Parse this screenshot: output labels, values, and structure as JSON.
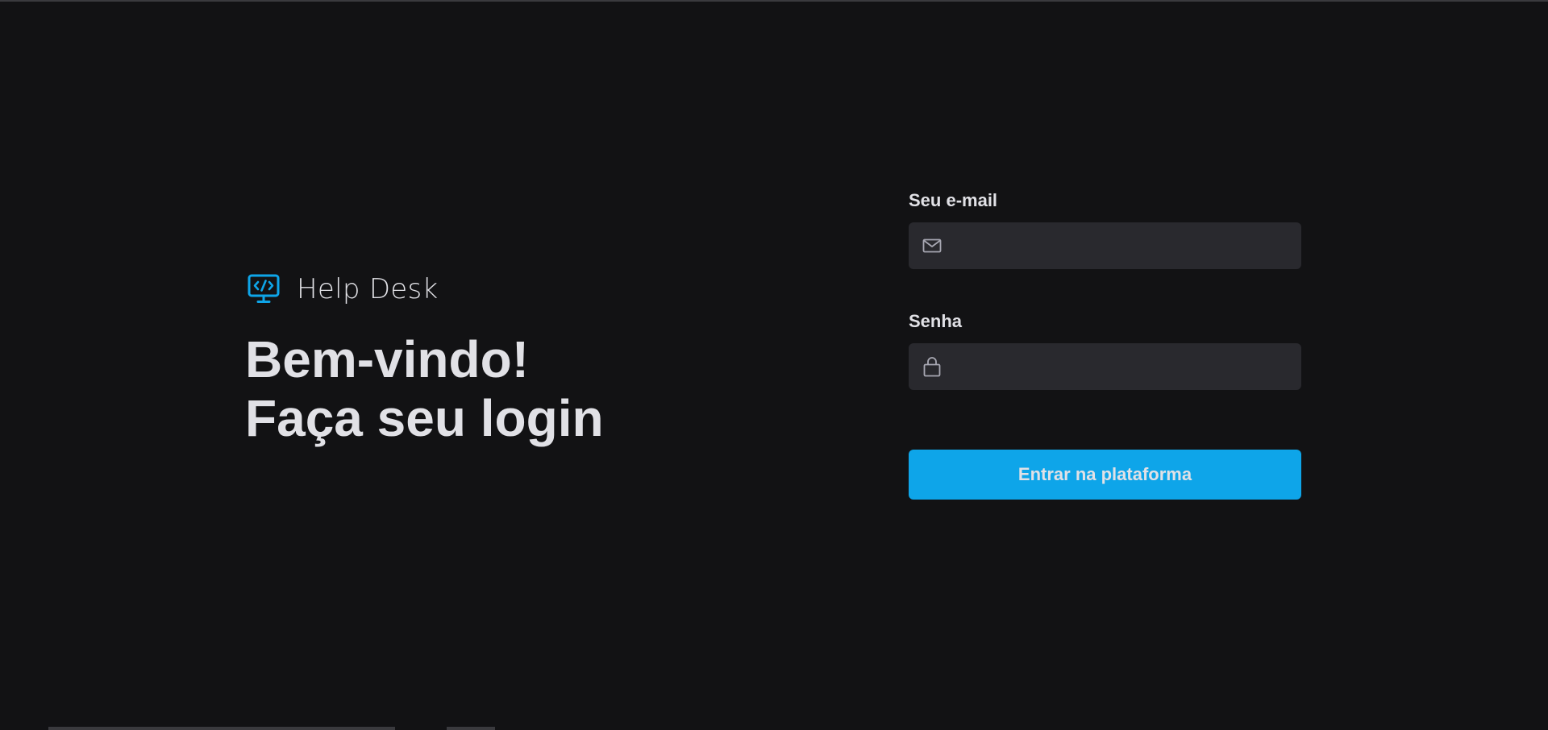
{
  "brand": {
    "name": "Help Desk",
    "icon": "monitor-code-icon",
    "accent_color": "#0ea5e9"
  },
  "headline": {
    "line1": "Bem-vindo!",
    "line2": "Faça seu login"
  },
  "form": {
    "email": {
      "label": "Seu e-mail",
      "value": "",
      "placeholder": "",
      "icon": "mail-icon"
    },
    "password": {
      "label": "Senha",
      "value": "",
      "placeholder": "",
      "icon": "lock-icon"
    },
    "submit_label": "Entrar na plataforma"
  },
  "colors": {
    "background": "#121214",
    "input_background": "#29292e",
    "button": "#0ea5e9",
    "text": "#e1e1e6"
  }
}
